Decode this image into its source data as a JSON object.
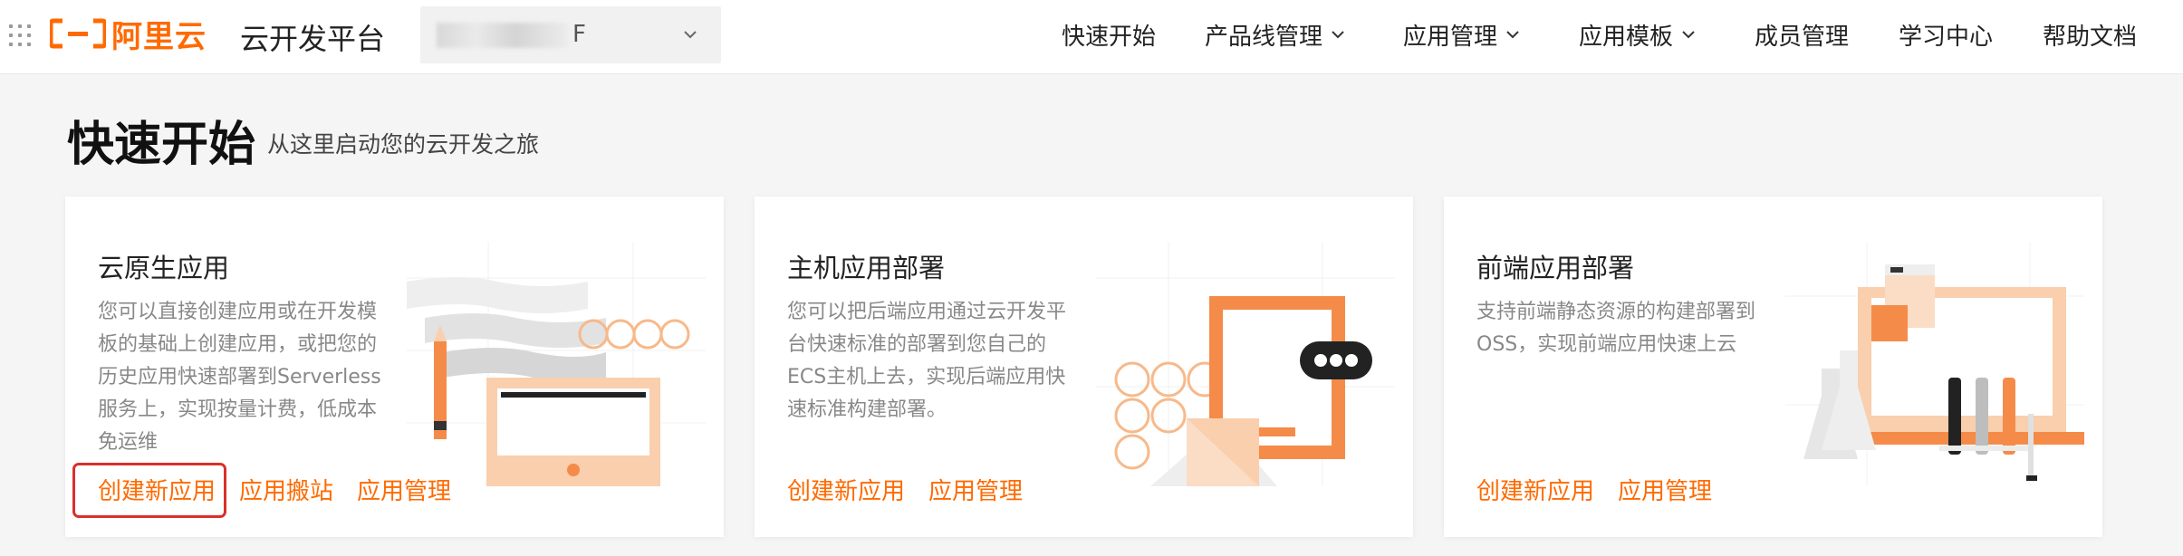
{
  "header": {
    "logo_text": "阿里云",
    "app_title": "云开发平台",
    "selector_value": "F",
    "nav": [
      {
        "label": "快速开始",
        "has_dropdown": false
      },
      {
        "label": "产品线管理",
        "has_dropdown": true
      },
      {
        "label": "应用管理",
        "has_dropdown": true
      },
      {
        "label": "应用模板",
        "has_dropdown": true
      },
      {
        "label": "成员管理",
        "has_dropdown": false
      },
      {
        "label": "学习中心",
        "has_dropdown": false
      },
      {
        "label": "帮助文档",
        "has_dropdown": false
      }
    ]
  },
  "page": {
    "title": "快速开始",
    "subtitle": "从这里启动您的云开发之旅"
  },
  "cards": [
    {
      "title": "云原生应用",
      "description": "您可以直接创建应用或在开发模板的基础上创建应用，或把您的历史应用快速部署到Serverless服务上，实现按量计费，低成本免运维",
      "links": [
        "创建新应用",
        "应用搬站",
        "应用管理"
      ]
    },
    {
      "title": "主机应用部署",
      "description": "您可以把后端应用通过云开发平台快速标准的部署到您自己的ECS主机上去，实现后端应用快速标准构建部署。",
      "links": [
        "创建新应用",
        "应用管理"
      ]
    },
    {
      "title": "前端应用部署",
      "description": "支持前端静态资源的构建部署到OSS，实现前端应用快速上云",
      "links": [
        "创建新应用",
        "应用管理"
      ]
    }
  ],
  "colors": {
    "accent": "#ff6a00",
    "highlight": "#d9302b",
    "background": "#f5f5f6"
  },
  "icons": [
    "apps-grid-icon",
    "chevron-down-icon"
  ]
}
